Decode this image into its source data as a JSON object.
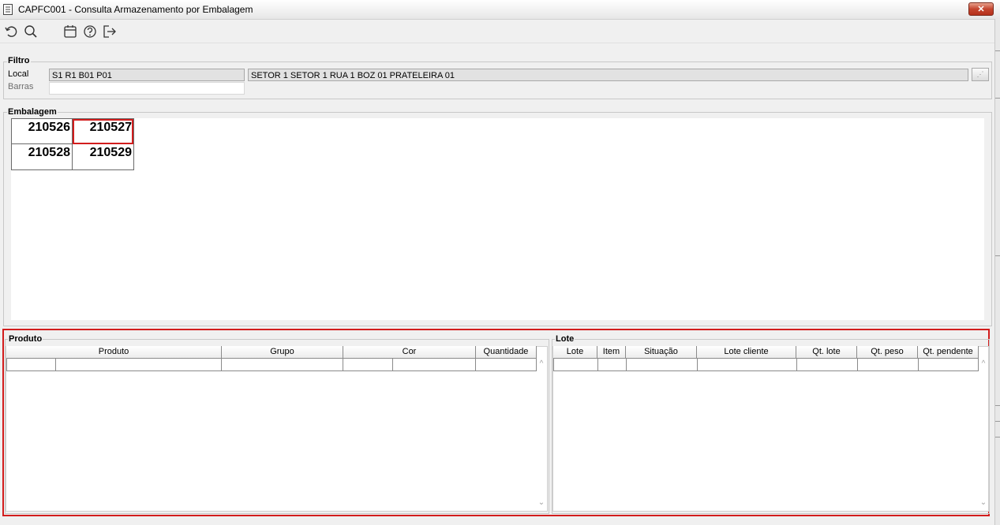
{
  "window": {
    "title": "CAPFC001 - Consulta Armazenamento por Embalagem",
    "close_label": "✕"
  },
  "toolbar": {
    "icons": [
      "refresh-icon",
      "search-icon",
      "calendar-icon",
      "help-icon",
      "exit-icon"
    ]
  },
  "filtro": {
    "legend": "Filtro",
    "local_label": "Local",
    "local_code": "S1 R1 B01 P01",
    "local_desc": "SETOR 1 SETOR 1 RUA 1 BOZ 01 PRATELEIRA 01",
    "barras_label": "Barras",
    "barras_value": "",
    "lookup_label": "⋰"
  },
  "embalagem": {
    "legend": "Embalagem",
    "cells": [
      "210526",
      "210527",
      "210528",
      "210529"
    ]
  },
  "produto": {
    "legend": "Produto",
    "columns": [
      "Produto",
      "Grupo",
      "Cor",
      "Quantidade"
    ]
  },
  "lote": {
    "legend": "Lote",
    "columns": [
      "Lote",
      "Item",
      "Situação",
      "Lote cliente",
      "Qt. lote",
      "Qt. peso",
      "Qt. pendente"
    ]
  },
  "colors": {
    "highlight": "#d21d1d",
    "close_button": "#c4452f"
  }
}
